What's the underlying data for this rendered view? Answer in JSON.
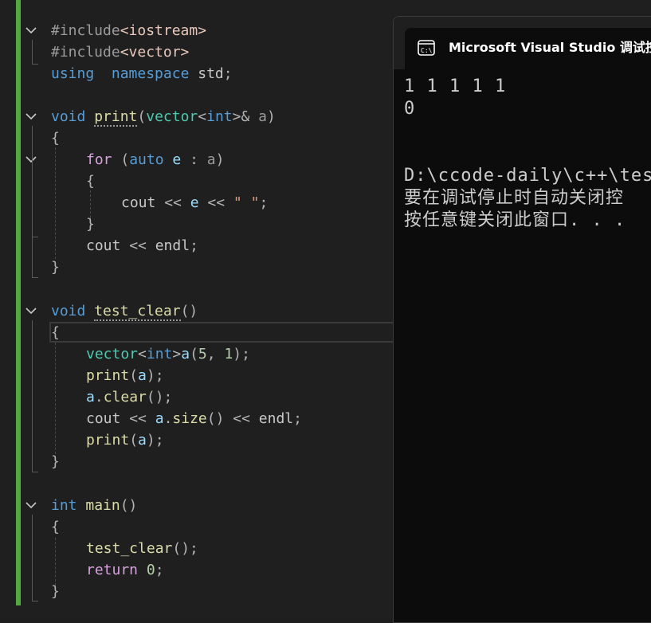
{
  "editor": {
    "lines": [
      {
        "id": "inc1",
        "segs": [
          [
            "pp",
            "#include"
          ],
          [
            "inc",
            "<iostream>"
          ]
        ]
      },
      {
        "id": "inc2",
        "segs": [
          [
            "pp",
            "#include"
          ],
          [
            "inc",
            "<vector>"
          ]
        ]
      },
      {
        "id": "using",
        "segs": [
          [
            "kw",
            "using"
          ],
          [
            "",
            "  "
          ],
          [
            "kw",
            "namespace"
          ],
          [
            "ns",
            " std"
          ],
          [
            "op",
            ";"
          ]
        ]
      },
      {
        "id": "print-sig",
        "segs": [
          [
            "kw",
            "void"
          ],
          [
            "",
            " "
          ],
          [
            "fn",
            "print"
          ],
          [
            "op",
            "("
          ],
          [
            "ty",
            "vector"
          ],
          [
            "op",
            "<"
          ],
          [
            "kw",
            "int"
          ],
          [
            "op",
            ">&"
          ],
          [
            "pm",
            " a"
          ],
          [
            "op",
            ")"
          ]
        ]
      },
      {
        "id": "print-open",
        "segs": [
          [
            "op",
            "{"
          ]
        ]
      },
      {
        "id": "for",
        "segs": [
          [
            "",
            ""
          ],
          [
            "ctl",
            "for"
          ],
          [
            "op",
            " ("
          ],
          [
            "kw",
            "auto"
          ],
          [
            "lv",
            " e"
          ],
          [
            "op",
            " : "
          ],
          [
            "pm",
            "a"
          ],
          [
            "op",
            ")"
          ]
        ]
      },
      {
        "id": "for-open",
        "segs": [
          [
            "op",
            "{"
          ]
        ]
      },
      {
        "id": "cout-e",
        "segs": [
          [
            "ns",
            "cout"
          ],
          [
            "op",
            " << "
          ],
          [
            "lv",
            "e"
          ],
          [
            "op",
            " << "
          ],
          [
            "str",
            "\" \""
          ],
          [
            "op",
            ";"
          ]
        ]
      },
      {
        "id": "for-close",
        "segs": [
          [
            "op",
            "}"
          ]
        ]
      },
      {
        "id": "cout-endl",
        "segs": [
          [
            "ns",
            "cout"
          ],
          [
            "op",
            " << "
          ],
          [
            "ns",
            "endl"
          ],
          [
            "op",
            ";"
          ]
        ]
      },
      {
        "id": "print-close",
        "segs": [
          [
            "op",
            "}"
          ]
        ]
      },
      {
        "id": "test-sig",
        "segs": [
          [
            "kw",
            "void"
          ],
          [
            "",
            " "
          ],
          [
            "fn",
            "test_clear"
          ],
          [
            "op",
            "()"
          ]
        ]
      },
      {
        "id": "test-open",
        "segs": [
          [
            "op",
            "{"
          ]
        ]
      },
      {
        "id": "vec-decl",
        "segs": [
          [
            "ty",
            "vector"
          ],
          [
            "op",
            "<"
          ],
          [
            "kw",
            "int"
          ],
          [
            "op",
            ">"
          ],
          [
            "lv",
            "a"
          ],
          [
            "op",
            "("
          ],
          [
            "num",
            "5"
          ],
          [
            "op",
            ", "
          ],
          [
            "num",
            "1"
          ],
          [
            "op",
            ");"
          ]
        ]
      },
      {
        "id": "print-a1",
        "segs": [
          [
            "fn",
            "print"
          ],
          [
            "op",
            "("
          ],
          [
            "lv",
            "a"
          ],
          [
            "op",
            ");"
          ]
        ]
      },
      {
        "id": "a-clear",
        "segs": [
          [
            "lv",
            "a"
          ],
          [
            "op",
            "."
          ],
          [
            "fn",
            "clear"
          ],
          [
            "op",
            "();"
          ]
        ]
      },
      {
        "id": "cout-size",
        "segs": [
          [
            "ns",
            "cout"
          ],
          [
            "op",
            " << "
          ],
          [
            "lv",
            "a"
          ],
          [
            "op",
            "."
          ],
          [
            "fn",
            "size"
          ],
          [
            "op",
            "() << "
          ],
          [
            "ns",
            "endl"
          ],
          [
            "op",
            ";"
          ]
        ]
      },
      {
        "id": "print-a2",
        "segs": [
          [
            "fn",
            "print"
          ],
          [
            "op",
            "("
          ],
          [
            "lv",
            "a"
          ],
          [
            "op",
            ");"
          ]
        ]
      },
      {
        "id": "test-close",
        "segs": [
          [
            "op",
            "}"
          ]
        ]
      },
      {
        "id": "main-sig",
        "segs": [
          [
            "kw",
            "int"
          ],
          [
            "",
            " "
          ],
          [
            "fn",
            "main"
          ],
          [
            "op",
            "()"
          ]
        ]
      },
      {
        "id": "main-open",
        "segs": [
          [
            "op",
            "{"
          ]
        ]
      },
      {
        "id": "call-test",
        "segs": [
          [
            "fn",
            "test_clear"
          ],
          [
            "op",
            "();"
          ]
        ]
      },
      {
        "id": "return",
        "segs": [
          [
            "ctl",
            "return"
          ],
          [
            "num",
            " 0"
          ],
          [
            "op",
            ";"
          ]
        ]
      },
      {
        "id": "main-close",
        "segs": [
          [
            "op",
            "}"
          ]
        ]
      }
    ]
  },
  "console": {
    "title": "Microsoft Visual Studio 调试控",
    "icon": "console-icon",
    "output": [
      "1 1 1 1 1",
      "0",
      "",
      "",
      "D:\\ccode-daily\\c++\\test",
      "要在调试停止时自动关闭控",
      "按任意键关闭此窗口. . ."
    ]
  }
}
